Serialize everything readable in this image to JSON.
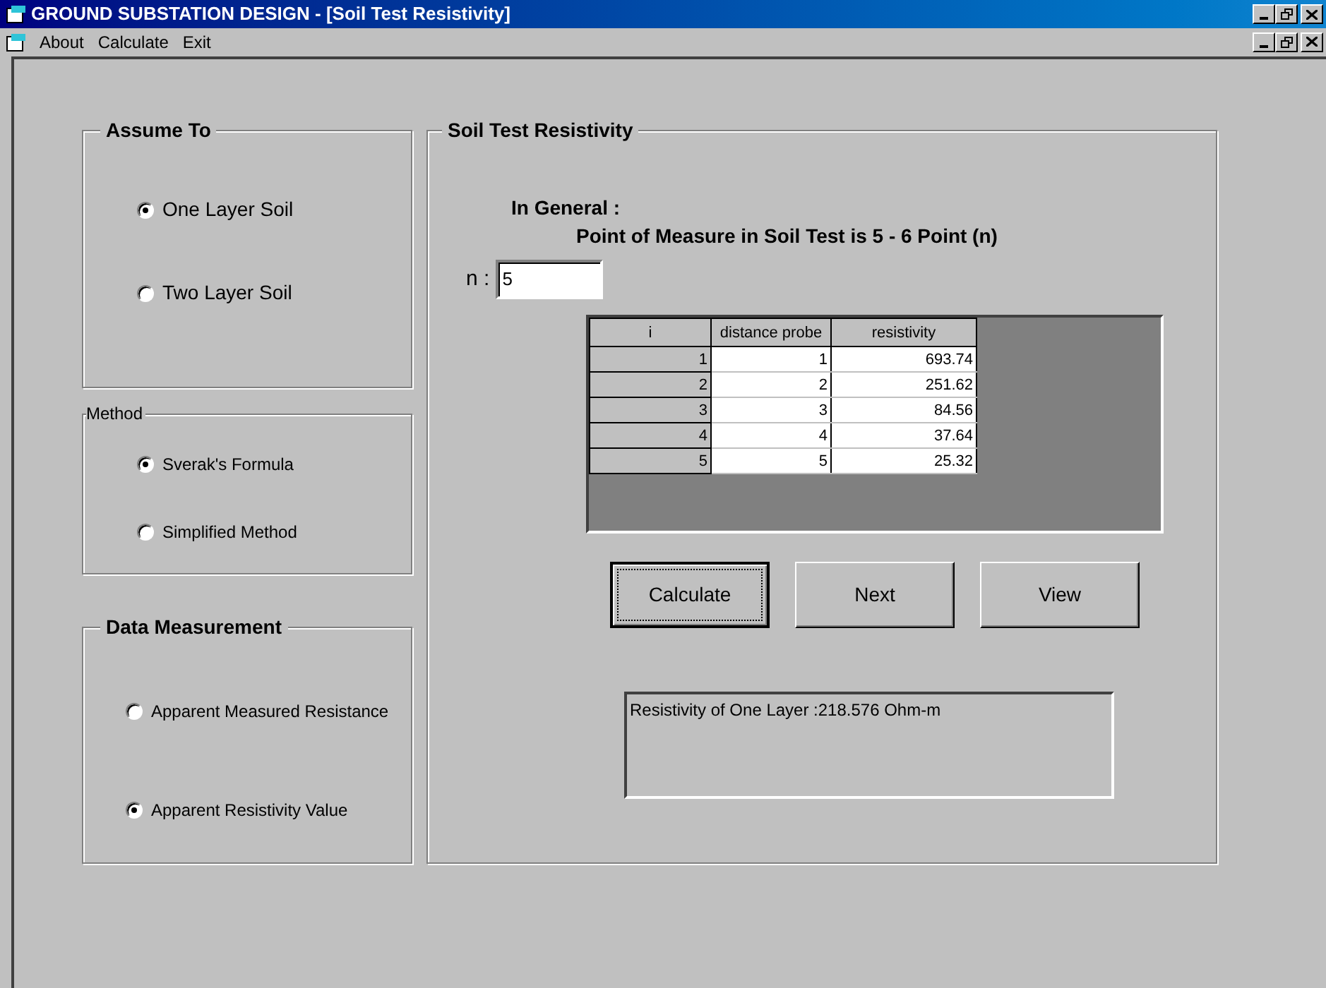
{
  "window": {
    "title": "GROUND SUBSTATION DESIGN - [Soil Test Resistivity]"
  },
  "menu": [
    "About",
    "Calculate",
    "Exit"
  ],
  "groups": [
    {
      "title": "Assume To",
      "options": [
        {
          "label": "One Layer Soil",
          "selected": true
        },
        {
          "label": "Two Layer Soil",
          "selected": false
        }
      ]
    },
    {
      "title": "Method",
      "options": [
        {
          "label": "Sverak's Formula",
          "selected": true
        },
        {
          "label": "Simplified Method",
          "selected": false
        }
      ]
    },
    {
      "title": "Data Measurement",
      "options": [
        {
          "label": "Apparent Measured Resistance",
          "selected": false
        },
        {
          "label": "Apparent Resistivity Value",
          "selected": true
        }
      ]
    }
  ],
  "soil_test": {
    "title": "Soil Test Resistivity",
    "general_label": "In General :",
    "general_text": "Point of Measure in Soil Test  is 5 - 6 Point (n)",
    "n_label": "n :",
    "n_value": "5",
    "table": {
      "columns": [
        "i",
        "distance probe",
        "resistivity"
      ],
      "rows": [
        [
          "1",
          "1",
          "693.74"
        ],
        [
          "2",
          "2",
          "251.62"
        ],
        [
          "3",
          "3",
          "84.56"
        ],
        [
          "4",
          "4",
          "37.64"
        ],
        [
          "5",
          "5",
          "25.32"
        ]
      ]
    },
    "buttons": [
      {
        "label": "Calculate",
        "focused": true
      },
      {
        "label": "Next",
        "focused": false
      },
      {
        "label": "View",
        "focused": false
      }
    ],
    "result": "Resistivity of One Layer :218.576 Ohm-m"
  }
}
